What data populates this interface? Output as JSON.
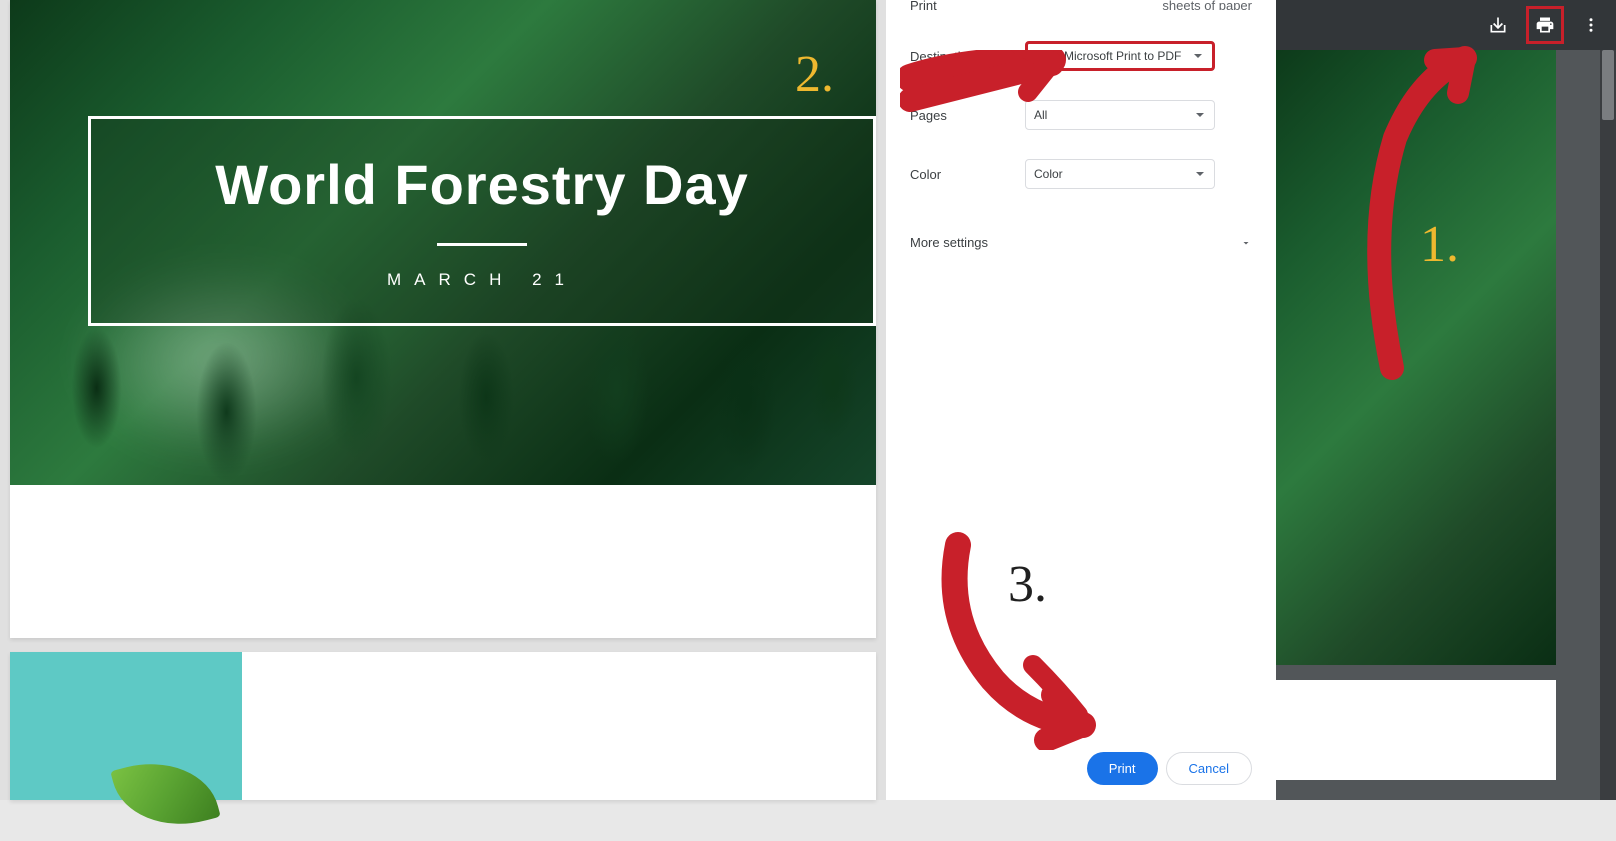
{
  "preview": {
    "title": "World Forestry Day",
    "subtitle": "MARCH 21"
  },
  "print": {
    "header_label": "Print",
    "sheets_text": "sheets of paper",
    "destination_label": "Destination",
    "destination_value": "Microsoft Print to PDF",
    "pages_label": "Pages",
    "pages_value": "All",
    "color_label": "Color",
    "color_value": "Color",
    "more_settings_label": "More settings",
    "print_button": "Print",
    "cancel_button": "Cancel"
  },
  "annotations": {
    "step1": "1.",
    "step2": "2.",
    "step3": "3."
  },
  "colors": {
    "annotation_yellow": "#eeb82f",
    "annotation_red": "#c8202a",
    "primary_blue": "#1a73e8"
  }
}
